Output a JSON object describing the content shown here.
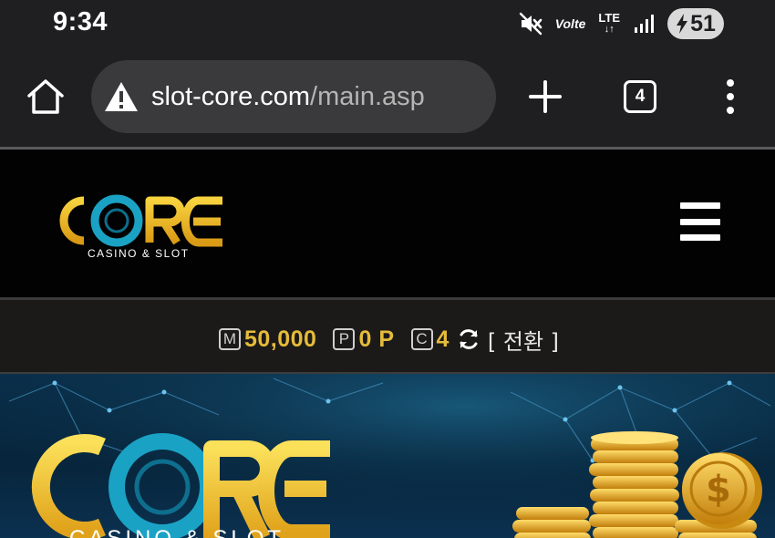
{
  "status_bar": {
    "time": "9:34",
    "volte": "Volte",
    "network": "LTE",
    "battery": "51",
    "icons": [
      "mute-icon",
      "volte-icon",
      "lte-icon",
      "signal-icon",
      "battery-charging-icon"
    ]
  },
  "browser": {
    "url_host": "slot-core.com",
    "url_path": "/main.asp",
    "tab_count": "4",
    "icons": [
      "home-icon",
      "warning-icon",
      "plus-icon",
      "tabs-icon",
      "more-vert-icon"
    ]
  },
  "site": {
    "logo_text": "CORE",
    "logo_tagline": "CASINO & SLOT",
    "menu_icon": "hamburger-icon"
  },
  "balance": {
    "money_badge": "M",
    "money_value": "50,000",
    "point_badge": "P",
    "point_value": "0 P",
    "coupon_badge": "C",
    "coupon_value": "4",
    "convert_label": "[ 전환 ]"
  },
  "banner": {
    "logo_text": "CORE",
    "logo_tagline": "CASINO & SLOT"
  },
  "colors": {
    "gold": "#e5bb3a",
    "teal_ring": "#1aa2c4",
    "banner_bg": "#07253c",
    "status_bg": "#1f1f21"
  }
}
